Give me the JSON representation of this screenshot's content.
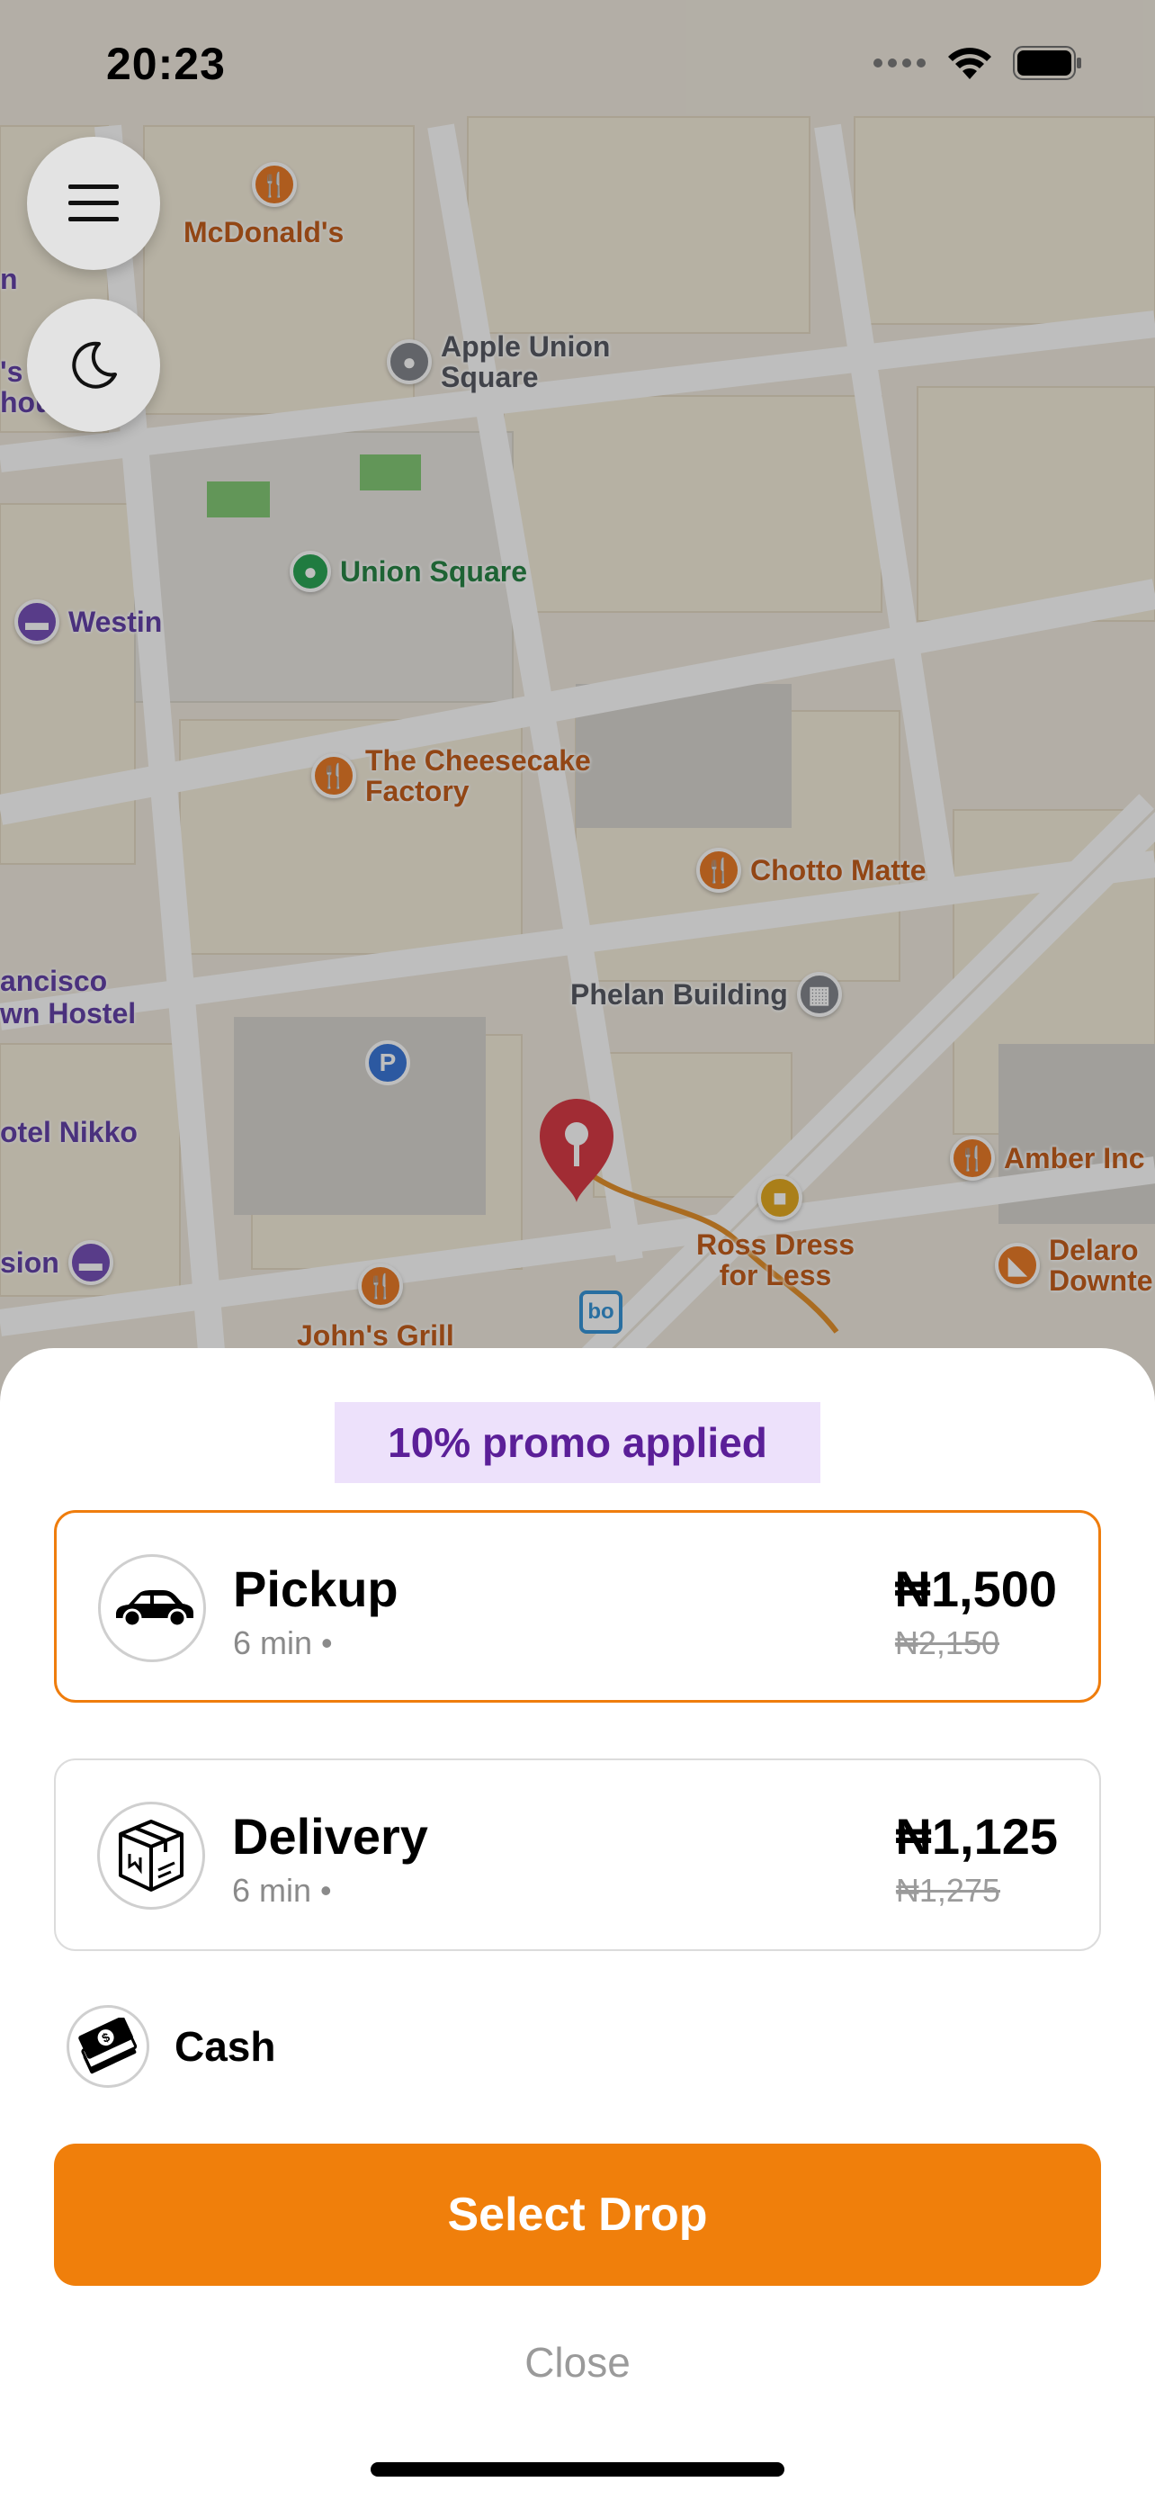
{
  "status_bar": {
    "time": "20:23",
    "icons": [
      "signal-dots-icon",
      "wifi-icon",
      "battery-icon"
    ]
  },
  "map": {
    "controls": [
      {
        "name": "menu-button",
        "icon": "hamburger-menu-icon"
      },
      {
        "name": "dark-mode-button",
        "icon": "moon-icon"
      }
    ],
    "places": {
      "mcdonalds": "McDonald's",
      "apple_union_square": "Apple Union\nSquare",
      "union_square": "Union Square",
      "westin": "Westin",
      "cheesecake_factory": "The Cheesecake\nFactory",
      "chotto_matte": "Chotto Matte",
      "phelan_building": "Phelan Building",
      "francisco_hostel": "ancisco\nwn Hostel",
      "hotel_nikko": "otel Nikko",
      "amber_india": "Amber Inc",
      "ross_dress": "Ross Dress\nfor Less",
      "delarosa": "Delaro\nDownte",
      "johns_grill": "John's Grill",
      "fusion": "sion",
      "left_edge_top": "n",
      "left_edge_mid": "'s\nhou"
    }
  },
  "sheet": {
    "promo": "10% promo applied",
    "options": [
      {
        "name": "Pickup",
        "eta": "6 min •",
        "price": "₦1,500",
        "old_price": "₦2,150",
        "selected": true,
        "icon": "car-icon"
      },
      {
        "name": "Delivery",
        "eta": "6 min •",
        "price": "₦1,125",
        "old_price": "₦1,275",
        "selected": false,
        "icon": "package-box-icon"
      }
    ],
    "payment": {
      "label": "Cash",
      "icon": "cash-money-icon"
    },
    "primary_button": "Select Drop",
    "close_button": "Close"
  },
  "colors": {
    "accent": "#f07f0b",
    "promo_bg": "#ede1fb",
    "promo_text": "#5b1f98",
    "map_dim": "rgba(40,40,40,0.30)"
  }
}
